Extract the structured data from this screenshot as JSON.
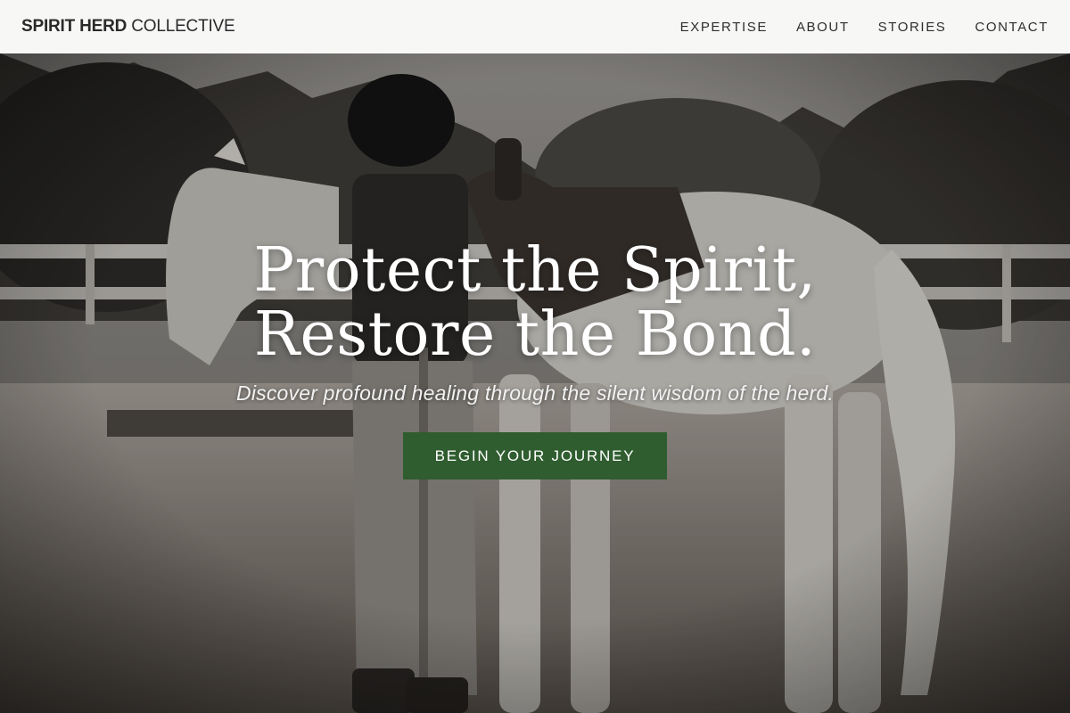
{
  "header": {
    "brand_strong": "SPIRIT HERD",
    "brand_light": " COLLECTIVE",
    "nav": [
      {
        "label": "EXPERTISE"
      },
      {
        "label": "ABOUT"
      },
      {
        "label": "STORIES"
      },
      {
        "label": "CONTACT"
      }
    ]
  },
  "hero": {
    "headline_line1": "Protect the Spirit,",
    "headline_line2": "Restore the Bond.",
    "subline": "Discover profound healing through the silent wisdom of the herd.",
    "cta_label": "BEGIN YOUR JOURNEY",
    "image_subject": "rider saddling a white horse in a sandy arena (black-and-white photo)"
  },
  "colors": {
    "header_bg": "#f7f7f6",
    "cta_bg": "#2f5d2f",
    "headline": "#ffffff"
  }
}
